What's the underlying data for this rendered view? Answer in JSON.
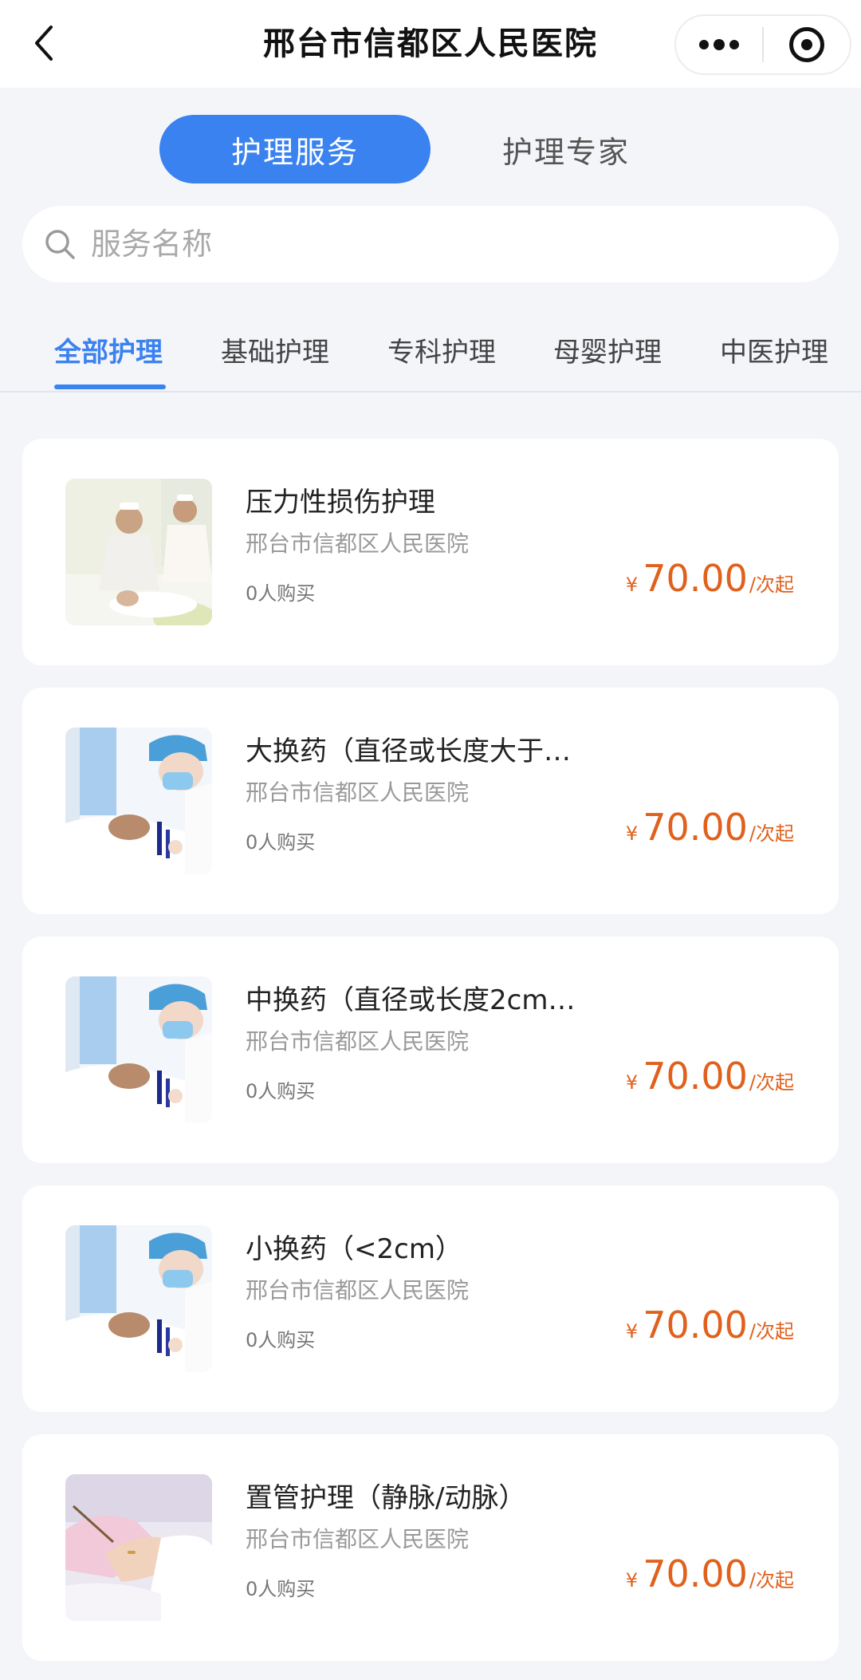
{
  "header": {
    "title": "邢台市信都区人民医院"
  },
  "segment": {
    "active": "护理服务",
    "inactive": "护理专家"
  },
  "search": {
    "placeholder": "服务名称"
  },
  "categories": [
    "全部护理",
    "基础护理",
    "专科护理",
    "母婴护理",
    "中医护理"
  ],
  "items": [
    {
      "title": "压力性损伤护理",
      "hospital": "邢台市信都区人民医院",
      "sold": "0人购买",
      "currency": "¥",
      "price": "70.00",
      "unit": "/次起",
      "image": "nurses-turning-patient"
    },
    {
      "title": "大换药（直径或长度大于…",
      "hospital": "邢台市信都区人民医院",
      "sold": "0人购买",
      "currency": "¥",
      "price": "70.00",
      "unit": "/次起",
      "image": "nurse-dressing-wound"
    },
    {
      "title": "中换药（直径或长度2cm…",
      "hospital": "邢台市信都区人民医院",
      "sold": "0人购买",
      "currency": "¥",
      "price": "70.00",
      "unit": "/次起",
      "image": "nurse-dressing-wound"
    },
    {
      "title": "小换药（<2cm）",
      "hospital": "邢台市信都区人民医院",
      "sold": "0人购买",
      "currency": "¥",
      "price": "70.00",
      "unit": "/次起",
      "image": "nurse-dressing-wound"
    },
    {
      "title": "置管护理（静脉/动脉）",
      "hospital": "邢台市信都区人民医院",
      "sold": "0人购买",
      "currency": "¥",
      "price": "70.00",
      "unit": "/次起",
      "image": "hands-with-catheter"
    }
  ],
  "colors": {
    "accent": "#3a82f0",
    "price": "#e0611d",
    "background": "#f4f5f9"
  }
}
